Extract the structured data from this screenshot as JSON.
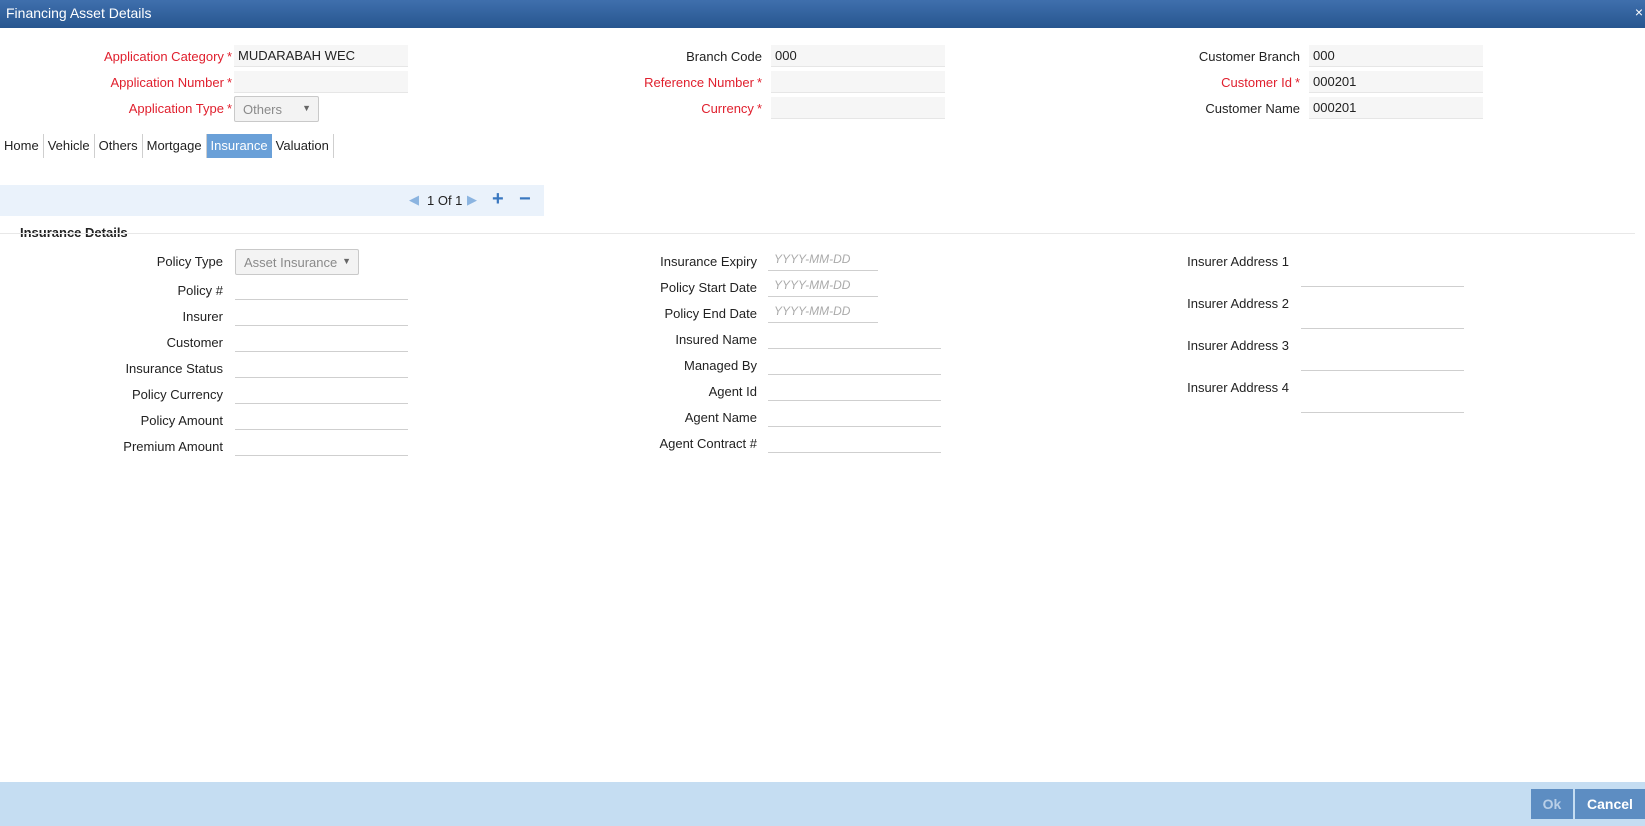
{
  "window": {
    "title": "Financing Asset Details",
    "close_glyph": "×"
  },
  "header": {
    "application_category": {
      "label": "Application Category",
      "value": "MUDARABAH WEC"
    },
    "application_number": {
      "label": "Application Number",
      "value": ""
    },
    "application_type": {
      "label": "Application Type",
      "value": "Others"
    },
    "branch_code": {
      "label": "Branch Code",
      "value": "000"
    },
    "reference_number": {
      "label": "Reference Number",
      "value": ""
    },
    "currency": {
      "label": "Currency",
      "value": ""
    },
    "customer_branch": {
      "label": "Customer Branch",
      "value": "000"
    },
    "customer_id": {
      "label": "Customer Id",
      "value": "000201"
    },
    "customer_name": {
      "label": "Customer Name",
      "value": "000201"
    },
    "required_marker": "*"
  },
  "tabs": [
    {
      "label": "Home"
    },
    {
      "label": "Vehicle"
    },
    {
      "label": "Others"
    },
    {
      "label": "Mortgage"
    },
    {
      "label": "Insurance",
      "active": true
    },
    {
      "label": "Valuation"
    }
  ],
  "pager": {
    "text": "1 Of 1",
    "add": "+",
    "remove": "−"
  },
  "insurance": {
    "section_title": "Insurance Details",
    "policy_type": {
      "label": "Policy Type",
      "value": "Asset Insurance"
    },
    "policy_no": {
      "label": "Policy #",
      "value": ""
    },
    "insurer": {
      "label": "Insurer",
      "value": ""
    },
    "customer": {
      "label": "Customer",
      "value": ""
    },
    "insurance_status": {
      "label": "Insurance Status",
      "value": ""
    },
    "policy_currency": {
      "label": "Policy Currency",
      "value": ""
    },
    "policy_amount": {
      "label": "Policy Amount",
      "value": ""
    },
    "premium_amount": {
      "label": "Premium Amount",
      "value": ""
    },
    "insurance_expiry": {
      "label": "Insurance Expiry",
      "placeholder": "YYYY-MM-DD"
    },
    "policy_start_date": {
      "label": "Policy Start Date",
      "placeholder": "YYYY-MM-DD"
    },
    "policy_end_date": {
      "label": "Policy End Date",
      "placeholder": "YYYY-MM-DD"
    },
    "insured_name": {
      "label": "Insured Name",
      "value": ""
    },
    "managed_by": {
      "label": "Managed By",
      "value": ""
    },
    "agent_id": {
      "label": "Agent Id",
      "value": ""
    },
    "agent_name": {
      "label": "Agent Name",
      "value": ""
    },
    "agent_contract": {
      "label": "Agent Contract #",
      "value": ""
    },
    "insurer_address_1": {
      "label": "Insurer Address 1",
      "value": ""
    },
    "insurer_address_2": {
      "label": "Insurer Address 2",
      "value": ""
    },
    "insurer_address_3": {
      "label": "Insurer Address 3",
      "value": ""
    },
    "insurer_address_4": {
      "label": "Insurer Address 4",
      "value": ""
    }
  },
  "footer": {
    "ok_label": "Ok",
    "cancel_label": "Cancel"
  },
  "colors": {
    "titlebar": "#2f5f9c",
    "active_tab": "#6aa0d8",
    "required": "#e0202e",
    "footer": "#c5ddf2",
    "button": "#5d8dc2"
  }
}
